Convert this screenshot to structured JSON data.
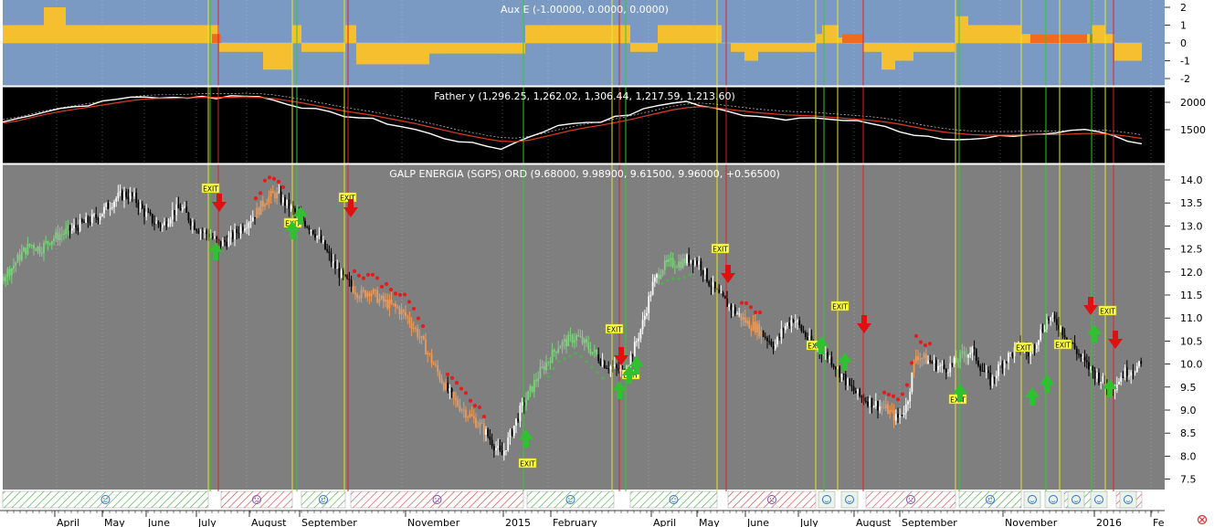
{
  "chart_data": [
    {
      "type": "bar",
      "title": "Aux E (-1.00000, 0.0000, 0.0000)",
      "y_ticks": [
        "2",
        "1",
        "0",
        "-1",
        "-2"
      ],
      "ylim": [
        -2.2,
        2.2
      ],
      "colors": {
        "background": "#7b9ac3",
        "bars": "#f6bf2f",
        "highlight": "#ee6b25"
      }
    },
    {
      "type": "line",
      "title": "Father y (1,296.25, 1,262.02, 1,306.44, 1,217.59, 1,213.60)",
      "y_ticks": [
        "2000",
        "1500"
      ],
      "ylim": [
        1100,
        2280
      ],
      "series": [
        {
          "role": "price",
          "color": "#ffffff",
          "values": [
            1640,
            1700,
            1780,
            1840,
            1890,
            1920,
            1960,
            2000,
            2050,
            2100,
            2110,
            2060,
            2080,
            2100,
            2110,
            2080,
            2110,
            2130,
            2100,
            2040,
            1980,
            1920,
            1860,
            1800,
            1760,
            1720,
            1680,
            1620,
            1560,
            1500,
            1420,
            1350,
            1300,
            1240,
            1200,
            1160,
            1260,
            1380,
            1480,
            1560,
            1620,
            1640,
            1660,
            1720,
            1780,
            1860,
            1940,
            2000,
            2010,
            1940,
            1880,
            1820,
            1780,
            1760,
            1720,
            1700,
            1740,
            1720,
            1680,
            1660,
            1640,
            1620,
            1560,
            1460,
            1400,
            1360,
            1330,
            1320,
            1340,
            1360,
            1380,
            1400,
            1420,
            1400,
            1420,
            1460,
            1480,
            1440,
            1380,
            1280,
            1240
          ]
        },
        {
          "role": "average",
          "color": "#e23b24",
          "values": [
            1620,
            1660,
            1720,
            1780,
            1830,
            1870,
            1910,
            1950,
            1990,
            2030,
            2060,
            2070,
            2070,
            2080,
            2090,
            2090,
            2090,
            2100,
            2090,
            2070,
            2030,
            1990,
            1940,
            1890,
            1840,
            1800,
            1760,
            1710,
            1660,
            1610,
            1550,
            1490,
            1430,
            1380,
            1330,
            1290,
            1280,
            1310,
            1370,
            1430,
            1490,
            1540,
            1580,
            1630,
            1680,
            1740,
            1800,
            1860,
            1900,
            1920,
            1900,
            1870,
            1840,
            1810,
            1790,
            1770,
            1760,
            1750,
            1730,
            1710,
            1690,
            1670,
            1640,
            1600,
            1550,
            1500,
            1460,
            1430,
            1410,
            1400,
            1400,
            1400,
            1410,
            1410,
            1410,
            1420,
            1430,
            1430,
            1410,
            1380,
            1340
          ]
        }
      ],
      "colors": {
        "background": "#000000"
      }
    },
    {
      "type": "candlestick",
      "title": "GALP ENERGIA (SGPS) ORD (9.68000, 9.98900, 9.61500, 9.96000, +0.56500)",
      "y_ticks": [
        "14.0",
        "13.5",
        "13.0",
        "12.5",
        "12.0",
        "11.5",
        "11.0",
        "10.5",
        "10.0",
        "9.5",
        "9.0",
        "8.5",
        "8.0",
        "7.5"
      ],
      "ylim": [
        7.2,
        14.35
      ],
      "price": [
        11.9,
        12.1,
        12.4,
        12.6,
        12.5,
        12.7,
        12.8,
        12.9,
        13.0,
        13.1,
        13.2,
        13.4,
        13.6,
        13.7,
        13.6,
        13.3,
        13.1,
        13.0,
        13.3,
        13.4,
        13.1,
        12.9,
        12.8,
        12.6,
        12.7,
        12.9,
        13.1,
        13.3,
        13.6,
        13.7,
        13.5,
        13.3,
        13.1,
        12.9,
        12.6,
        12.2,
        11.9,
        11.7,
        11.5,
        11.6,
        11.4,
        11.3,
        11.2,
        11.0,
        10.7,
        10.3,
        9.9,
        9.5,
        9.2,
        9.0,
        8.8,
        8.6,
        8.3,
        8.0,
        8.5,
        9.0,
        9.4,
        9.8,
        10.1,
        10.4,
        10.5,
        10.6,
        10.4,
        10.2,
        10.0,
        9.9,
        9.8,
        10.3,
        10.9,
        11.7,
        12.1,
        12.2,
        12.2,
        12.3,
        12.2,
        11.8,
        11.5,
        11.3,
        11.1,
        10.9,
        10.8,
        10.6,
        10.4,
        10.8,
        11.0,
        10.7,
        10.4,
        10.3,
        10.1,
        9.8,
        9.5,
        9.3,
        9.2,
        9.1,
        9.0,
        8.8,
        9.1,
        10.2,
        10.1,
        10.0,
        9.9,
        10.0,
        10.2,
        10.3,
        9.9,
        9.6,
        10.0,
        10.2,
        10.4,
        10.2,
        10.6,
        11.0,
        10.9,
        10.6,
        10.3,
        10.0,
        9.8,
        9.6,
        9.5,
        9.8,
        9.9,
        9.96
      ],
      "vertical_lines_yellow_x": [
        228,
        320,
        377,
        670,
        785,
        893,
        917,
        1046,
        1118,
        1160,
        1210
      ],
      "vertical_lines_red_x": [
        239,
        381,
        678,
        795,
        945,
        1219
      ],
      "vertical_lines_green_x": [
        230,
        325,
        573,
        685,
        902,
        1050,
        1145,
        1195
      ],
      "markers": {
        "exit": [
          {
            "label": "EXIT"
          },
          {
            "label": "EXIT"
          },
          {
            "label": "EXIT"
          },
          {
            "label": "EXIT"
          },
          {
            "label": "EXIT"
          },
          {
            "label": "EXIT"
          },
          {
            "label": "EXIT"
          },
          {
            "label": "EXIT"
          },
          {
            "label": "EXIT"
          },
          {
            "label": "EXIT"
          },
          {
            "label": "EXIT"
          },
          {
            "label": "EXIT"
          },
          {
            "label": "EXIT"
          }
        ],
        "down_arrows": 7,
        "up_arrows": 14
      },
      "colors": {
        "background": "#7f7f7f",
        "up_candle": "#ffffff",
        "down_candle": "#000000",
        "green_candle": "#7ed27e",
        "orange_candle": "#ee9a58",
        "dots": "#e61b1b",
        "exit_fill": "#ffff44",
        "arrow_up": "#30c030",
        "arrow_down": "#e01010"
      }
    }
  ],
  "x_axis": {
    "labels": [
      "April",
      "May",
      "June",
      "July",
      "August",
      "September",
      "November",
      "2015",
      "February",
      "April",
      "May",
      "June",
      "July",
      "August",
      "September",
      "November",
      "2016",
      "Fe"
    ]
  },
  "status_strip": {
    "segments": [
      {
        "kind": "green"
      },
      {
        "kind": "red"
      },
      {
        "kind": "green"
      },
      {
        "kind": "red"
      },
      {
        "kind": "green"
      },
      {
        "kind": "red"
      },
      {
        "kind": "green"
      },
      {
        "kind": "red"
      },
      {
        "kind": "green"
      },
      {
        "kind": "red"
      },
      {
        "kind": "green"
      },
      {
        "kind": "red"
      }
    ],
    "colors": {
      "green": "#3aa63a",
      "red": "#d83a3a"
    }
  }
}
